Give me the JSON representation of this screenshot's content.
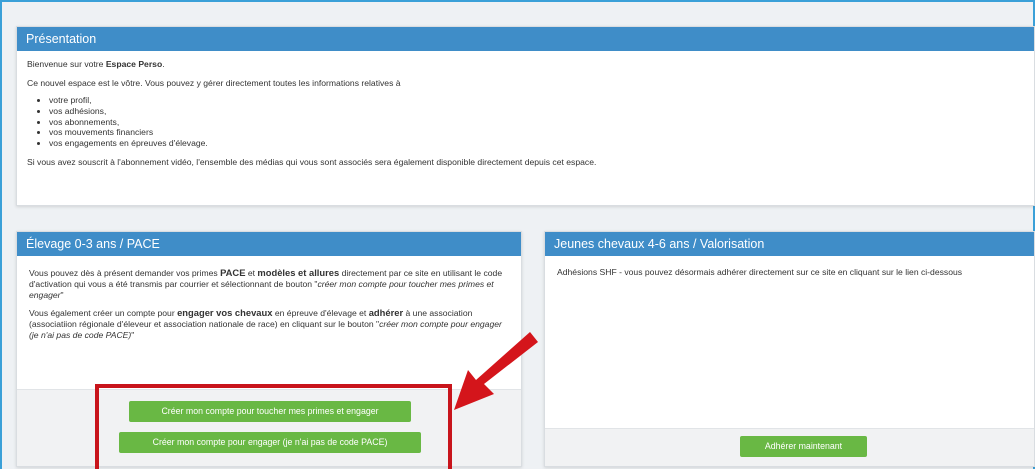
{
  "presentation": {
    "title": "Présentation",
    "welcome_prefix": "Bienvenue sur votre ",
    "welcome_bold": "Espace Perso",
    "welcome_suffix": ".",
    "intro": "Ce nouvel espace est le vôtre. Vous pouvez y gérer directement toutes les informations relatives à",
    "items": [
      "votre profil,",
      "vos adhésions,",
      "vos abonnements,",
      "vos mouvements financiers",
      "vos engagements en épreuves d'élevage."
    ],
    "video_note": "Si vous avez souscrit à l'abonnement vidéo, l'ensemble des médias qui vous sont associés sera également disponible directement depuis cet espace."
  },
  "elevage": {
    "title": "Élevage 0-3 ans / PACE",
    "p1_a": "Vous pouvez dès à présent demander vos primes ",
    "p1_b1": "PACE",
    "p1_c": " et ",
    "p1_b2": "modèles et allures",
    "p1_d": " directement par ce site en utilisant le code d'activation qui vous a été transmis par courrier et sélectionnant de bouton \"",
    "p1_i": "créer mon compte pour toucher mes primes et engager",
    "p1_e": "\"",
    "p2_a": "Vous également créer un compte pour ",
    "p2_b1": "engager vos chevaux",
    "p2_c": " en épreuve d'élevage et ",
    "p2_b2": "adhérer",
    "p2_d": " à une association (associatiion régionale d'éleveur et association nationale de race) en cliquant sur le bouton \"",
    "p2_i": "créer mon compte pour engager (je n'ai pas de code PACE)",
    "p2_e": "\"",
    "button_primes": "Créer mon compte pour toucher mes primes et engager",
    "button_engager": "Créer mon compte pour engager (je n'ai pas de code PACE)"
  },
  "jeunes": {
    "title": "Jeunes chevaux 4-6 ans / Valorisation",
    "text": "Adhésions SHF - vous pouvez désormais adhérer directement sur ce site en cliquant sur le lien ci-dessous",
    "button_adherer": "Adhérer maintenant"
  },
  "colors": {
    "header_blue": "#3f8dc8",
    "button_green": "#69b844",
    "highlight_red": "#c8141b"
  }
}
